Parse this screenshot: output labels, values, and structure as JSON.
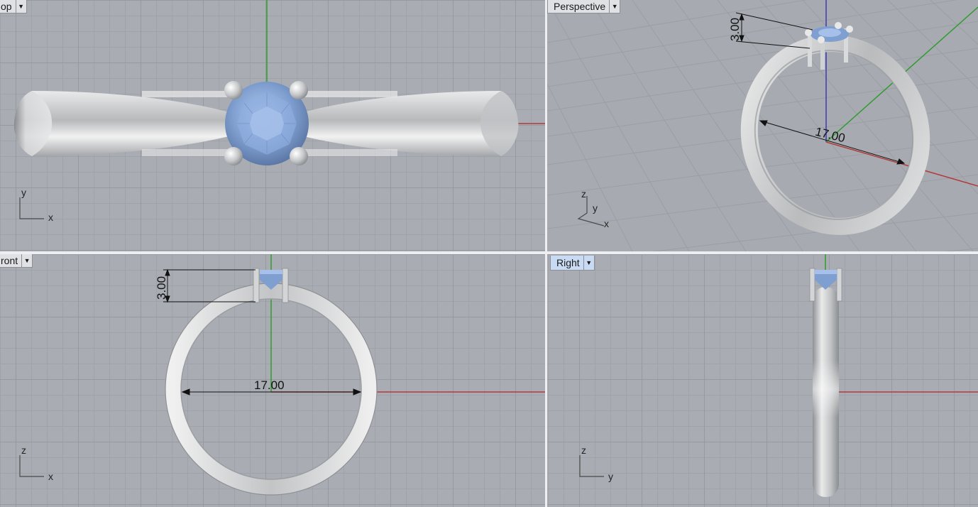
{
  "viewports": {
    "top": {
      "label": "op",
      "dropdown": "▼",
      "axis1": "y",
      "axis2": "x"
    },
    "perspective": {
      "label": "Perspective",
      "dropdown": "▼",
      "axis_z": "z",
      "axis_y": "y",
      "axis_x": "x"
    },
    "front": {
      "label": "ront",
      "dropdown": "▼",
      "axis1": "z",
      "axis2": "x"
    },
    "right": {
      "label": "Right",
      "dropdown": "▼",
      "axis1": "z",
      "axis2": "y"
    }
  },
  "dimensions": {
    "inner_diameter": "17.00",
    "prong_height": "3.00"
  },
  "colors": {
    "viewport_bg": "#a9adb3",
    "gem": "#7f9fd0",
    "metal": "#c8cacc",
    "x_axis": "#b23a3a",
    "y_axis": "#2e9b2e",
    "z_axis": "#3a3ab0",
    "active_tab": "#c9daf3"
  }
}
